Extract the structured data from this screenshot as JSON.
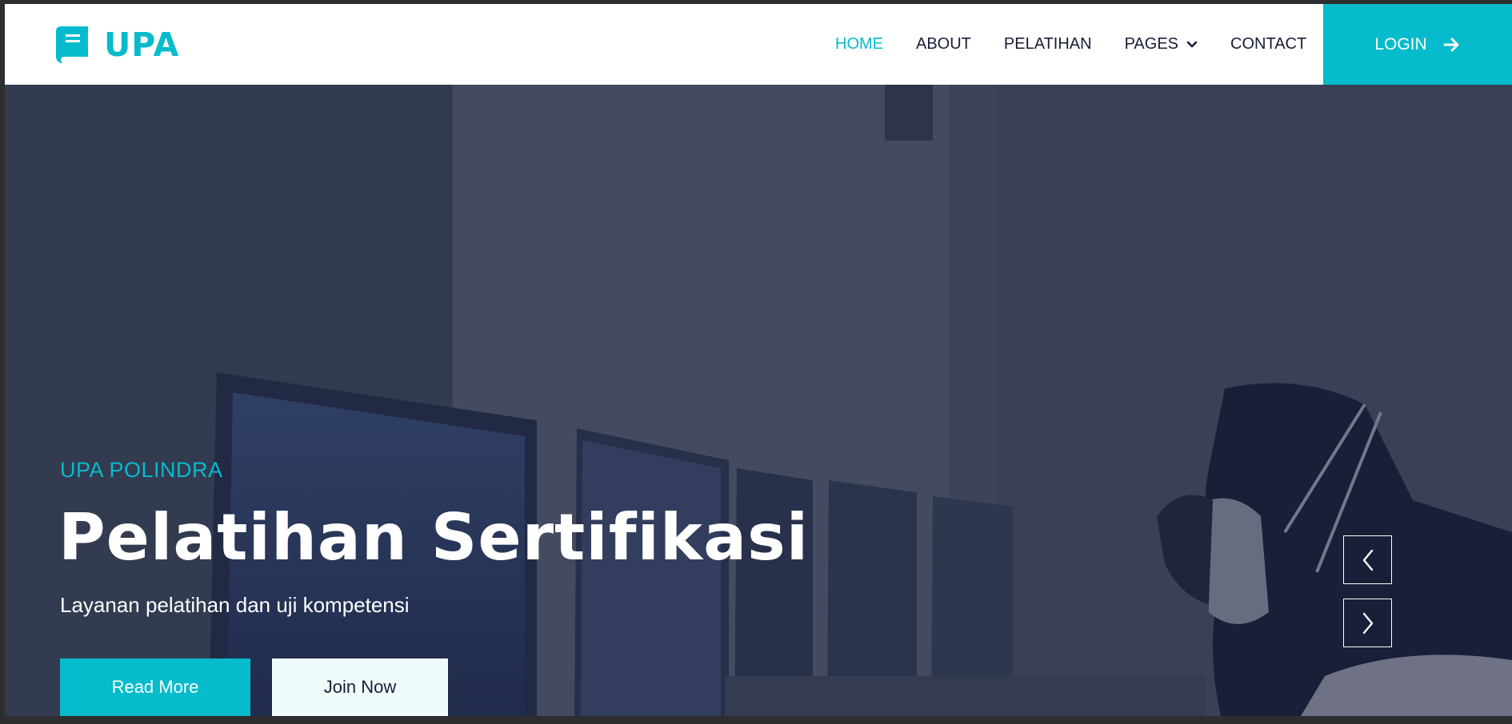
{
  "navbar": {
    "brand": "UPA",
    "brand_icon": "book-icon",
    "items": [
      {
        "label": "HOME",
        "active": true
      },
      {
        "label": "ABOUT",
        "active": false
      },
      {
        "label": "PELATIHAN",
        "active": false
      },
      {
        "label": "PAGES",
        "active": false,
        "dropdown": true
      },
      {
        "label": "CONTACT",
        "active": false
      }
    ],
    "login_label": "LOGIN",
    "login_icon": "arrow-right-icon"
  },
  "hero": {
    "subtitle": "UPA POLINDRA",
    "title": "Pelatihan Sertifikasi",
    "description": "Layanan pelatihan dan uji kompetensi",
    "primary_button": "Read More",
    "secondary_button": "Join Now",
    "prev_icon": "chevron-left-icon",
    "next_icon": "chevron-right-icon"
  },
  "colors": {
    "accent": "#06bbcc",
    "dark": "#181d38",
    "light": "#f0fbfc"
  }
}
